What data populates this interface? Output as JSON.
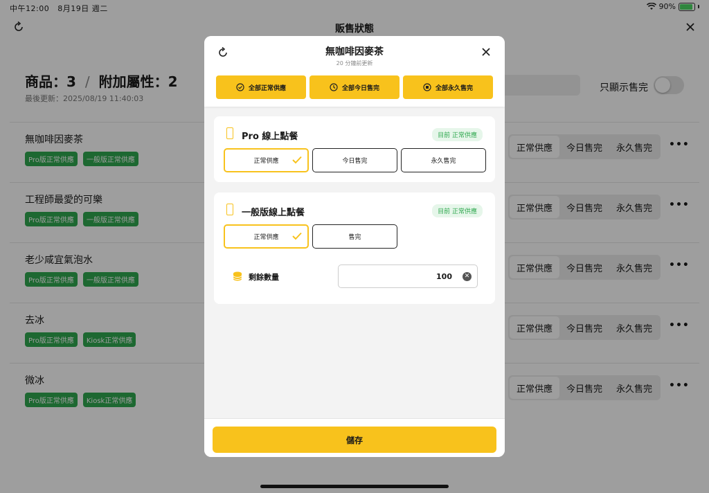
{
  "status_bar": {
    "time": "中午12:00",
    "date": "8月19日 週二",
    "battery": "90%",
    "battery_level": 0.9
  },
  "nav": {
    "title": "販售狀態"
  },
  "summary": {
    "products_label": "商品：3",
    "separator": "/",
    "attributes_label": "附加屬性：2",
    "last_updated": "最後更新：2025/08/19 11:40:03"
  },
  "filter": {
    "sold_out_only_label": "只顯示售完"
  },
  "segments": {
    "normal": "正常供應",
    "today": "今日售完",
    "permanent": "永久售完"
  },
  "more_label": "•••",
  "products": [
    {
      "name": "無咖啡因麥茶",
      "tags": [
        "Pro版正常供應",
        "一般版正常供應"
      ]
    },
    {
      "name": "工程師最愛的可樂",
      "tags": [
        "Pro版正常供應",
        "一般版正常供應"
      ]
    },
    {
      "name": "老少咸宜氣泡水",
      "tags": [
        "Pro版正常供應",
        "一般版正常供應"
      ]
    },
    {
      "name": "去冰",
      "tags": [
        "Pro版正常供應",
        "Kiosk正常供應"
      ]
    },
    {
      "name": "微冰",
      "tags": [
        "Pro版正常供應",
        "Kiosk正常供應"
      ]
    }
  ],
  "modal": {
    "title": "無咖啡因麥茶",
    "subtitle": "20 分鐘前更新",
    "bulk": {
      "all_normal": "全部正常供應",
      "all_today": "全部今日售完",
      "all_permanent": "全部永久售完"
    },
    "cards": [
      {
        "title": "Pro 線上點餐",
        "status": "目前 正常供應",
        "options": [
          "正常供應",
          "今日售完",
          "永久售完"
        ],
        "selected_option": "正常供應"
      },
      {
        "title": "一般版線上點餐",
        "status": "目前 正常供應",
        "options": [
          "正常供應",
          "售完"
        ],
        "selected_option": "正常供應",
        "quantity_label": "剩餘數量",
        "quantity_value": "100"
      }
    ],
    "save_label": "儲存"
  },
  "colors": {
    "accent": "#f8c21c",
    "tag_green": "#2fa84f",
    "status_green": "#2fa84f"
  },
  "icons": {
    "nav_refresh": "refresh-icon",
    "nav_close": "close-icon",
    "modal_refresh": "refresh-icon",
    "modal_close": "close-icon",
    "all_normal": "check-circle-icon",
    "all_today": "clock-icon",
    "all_permanent": "stop-circle-icon",
    "card": "phone-icon",
    "selected": "checkmark-icon",
    "quantity": "coin-stack-icon",
    "clear": "clear-icon",
    "wifi": "wifi-icon",
    "battery": "battery-icon"
  }
}
